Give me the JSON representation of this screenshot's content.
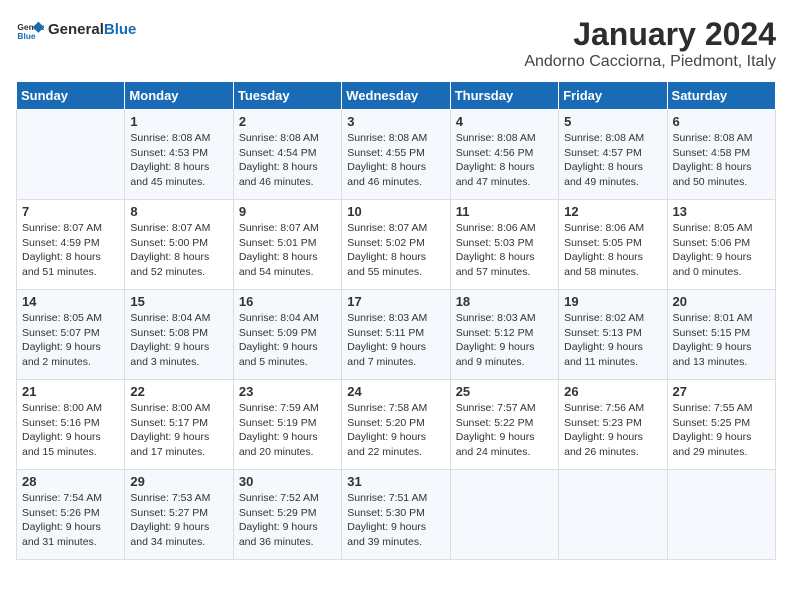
{
  "header": {
    "logo_general": "General",
    "logo_blue": "Blue",
    "title": "January 2024",
    "subtitle": "Andorno Cacciorna, Piedmont, Italy"
  },
  "days_of_week": [
    "Sunday",
    "Monday",
    "Tuesday",
    "Wednesday",
    "Thursday",
    "Friday",
    "Saturday"
  ],
  "weeks": [
    [
      {
        "day": "",
        "info": ""
      },
      {
        "day": "1",
        "info": "Sunrise: 8:08 AM\nSunset: 4:53 PM\nDaylight: 8 hours\nand 45 minutes."
      },
      {
        "day": "2",
        "info": "Sunrise: 8:08 AM\nSunset: 4:54 PM\nDaylight: 8 hours\nand 46 minutes."
      },
      {
        "day": "3",
        "info": "Sunrise: 8:08 AM\nSunset: 4:55 PM\nDaylight: 8 hours\nand 46 minutes."
      },
      {
        "day": "4",
        "info": "Sunrise: 8:08 AM\nSunset: 4:56 PM\nDaylight: 8 hours\nand 47 minutes."
      },
      {
        "day": "5",
        "info": "Sunrise: 8:08 AM\nSunset: 4:57 PM\nDaylight: 8 hours\nand 49 minutes."
      },
      {
        "day": "6",
        "info": "Sunrise: 8:08 AM\nSunset: 4:58 PM\nDaylight: 8 hours\nand 50 minutes."
      }
    ],
    [
      {
        "day": "7",
        "info": "Sunrise: 8:07 AM\nSunset: 4:59 PM\nDaylight: 8 hours\nand 51 minutes."
      },
      {
        "day": "8",
        "info": "Sunrise: 8:07 AM\nSunset: 5:00 PM\nDaylight: 8 hours\nand 52 minutes."
      },
      {
        "day": "9",
        "info": "Sunrise: 8:07 AM\nSunset: 5:01 PM\nDaylight: 8 hours\nand 54 minutes."
      },
      {
        "day": "10",
        "info": "Sunrise: 8:07 AM\nSunset: 5:02 PM\nDaylight: 8 hours\nand 55 minutes."
      },
      {
        "day": "11",
        "info": "Sunrise: 8:06 AM\nSunset: 5:03 PM\nDaylight: 8 hours\nand 57 minutes."
      },
      {
        "day": "12",
        "info": "Sunrise: 8:06 AM\nSunset: 5:05 PM\nDaylight: 8 hours\nand 58 minutes."
      },
      {
        "day": "13",
        "info": "Sunrise: 8:05 AM\nSunset: 5:06 PM\nDaylight: 9 hours\nand 0 minutes."
      }
    ],
    [
      {
        "day": "14",
        "info": "Sunrise: 8:05 AM\nSunset: 5:07 PM\nDaylight: 9 hours\nand 2 minutes."
      },
      {
        "day": "15",
        "info": "Sunrise: 8:04 AM\nSunset: 5:08 PM\nDaylight: 9 hours\nand 3 minutes."
      },
      {
        "day": "16",
        "info": "Sunrise: 8:04 AM\nSunset: 5:09 PM\nDaylight: 9 hours\nand 5 minutes."
      },
      {
        "day": "17",
        "info": "Sunrise: 8:03 AM\nSunset: 5:11 PM\nDaylight: 9 hours\nand 7 minutes."
      },
      {
        "day": "18",
        "info": "Sunrise: 8:03 AM\nSunset: 5:12 PM\nDaylight: 9 hours\nand 9 minutes."
      },
      {
        "day": "19",
        "info": "Sunrise: 8:02 AM\nSunset: 5:13 PM\nDaylight: 9 hours\nand 11 minutes."
      },
      {
        "day": "20",
        "info": "Sunrise: 8:01 AM\nSunset: 5:15 PM\nDaylight: 9 hours\nand 13 minutes."
      }
    ],
    [
      {
        "day": "21",
        "info": "Sunrise: 8:00 AM\nSunset: 5:16 PM\nDaylight: 9 hours\nand 15 minutes."
      },
      {
        "day": "22",
        "info": "Sunrise: 8:00 AM\nSunset: 5:17 PM\nDaylight: 9 hours\nand 17 minutes."
      },
      {
        "day": "23",
        "info": "Sunrise: 7:59 AM\nSunset: 5:19 PM\nDaylight: 9 hours\nand 20 minutes."
      },
      {
        "day": "24",
        "info": "Sunrise: 7:58 AM\nSunset: 5:20 PM\nDaylight: 9 hours\nand 22 minutes."
      },
      {
        "day": "25",
        "info": "Sunrise: 7:57 AM\nSunset: 5:22 PM\nDaylight: 9 hours\nand 24 minutes."
      },
      {
        "day": "26",
        "info": "Sunrise: 7:56 AM\nSunset: 5:23 PM\nDaylight: 9 hours\nand 26 minutes."
      },
      {
        "day": "27",
        "info": "Sunrise: 7:55 AM\nSunset: 5:25 PM\nDaylight: 9 hours\nand 29 minutes."
      }
    ],
    [
      {
        "day": "28",
        "info": "Sunrise: 7:54 AM\nSunset: 5:26 PM\nDaylight: 9 hours\nand 31 minutes."
      },
      {
        "day": "29",
        "info": "Sunrise: 7:53 AM\nSunset: 5:27 PM\nDaylight: 9 hours\nand 34 minutes."
      },
      {
        "day": "30",
        "info": "Sunrise: 7:52 AM\nSunset: 5:29 PM\nDaylight: 9 hours\nand 36 minutes."
      },
      {
        "day": "31",
        "info": "Sunrise: 7:51 AM\nSunset: 5:30 PM\nDaylight: 9 hours\nand 39 minutes."
      },
      {
        "day": "",
        "info": ""
      },
      {
        "day": "",
        "info": ""
      },
      {
        "day": "",
        "info": ""
      }
    ]
  ]
}
